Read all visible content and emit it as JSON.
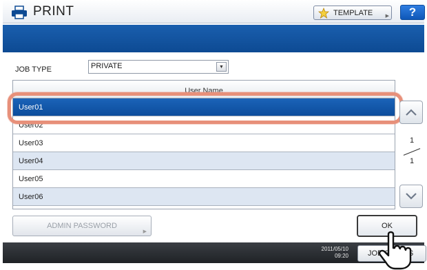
{
  "titlebar": {
    "title": "PRINT",
    "template_label": "TEMPLATE",
    "help_label": "?"
  },
  "job_type": {
    "label": "JOB TYPE",
    "selected": "PRIVATE"
  },
  "user_list": {
    "header": "User Name",
    "rows": [
      "User01",
      "User02",
      "User03",
      "User04",
      "User05",
      "User06"
    ],
    "selected_index": 0
  },
  "pager": {
    "current": "1",
    "total": "1"
  },
  "buttons": {
    "admin_password": "ADMIN PASSWORD",
    "ok": "OK",
    "job_status": "JOB STATUS"
  },
  "status": {
    "date": "2011/05/10",
    "time": "09:20"
  },
  "colors": {
    "accent": "#0d4a93",
    "highlight": "#e7907a"
  },
  "icons": [
    "print-icon",
    "star-icon",
    "chevron-up-icon",
    "chevron-down-icon",
    "hand-pointer-icon"
  ]
}
